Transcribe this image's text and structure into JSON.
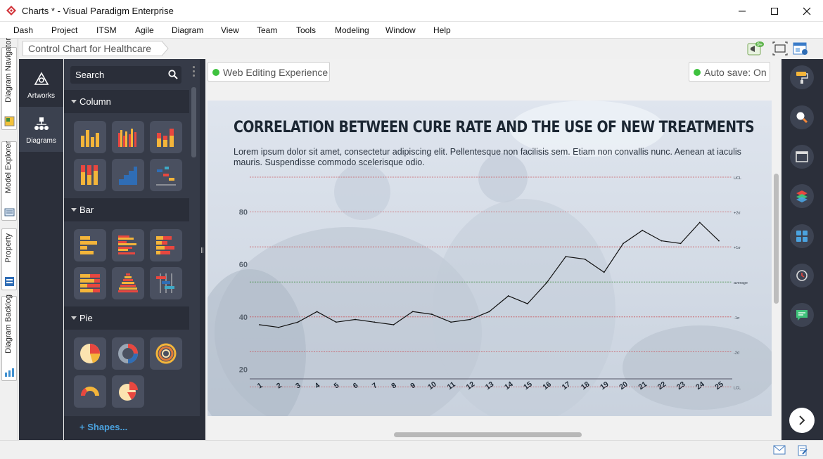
{
  "window": {
    "title": "Charts * - Visual Paradigm Enterprise"
  },
  "menu": [
    "Dash",
    "Project",
    "ITSM",
    "Agile",
    "Diagram",
    "View",
    "Team",
    "Tools",
    "Modeling",
    "Window",
    "Help"
  ],
  "breadcrumb": "Control Chart for Healthcare",
  "notification_badge": "9+",
  "left_tabs": [
    "Diagram Navigator",
    "Model Explorer",
    "Property",
    "Diagram Backlog"
  ],
  "nav": {
    "artworks": "Artworks",
    "diagrams": "Diagrams"
  },
  "palette": {
    "search_placeholder": "Search",
    "categories": [
      "Column",
      "Bar",
      "Pie"
    ],
    "shapes_link": "+ Shapes..."
  },
  "canvas": {
    "web_editing": "Web Editing Experience",
    "autosave": "Auto save: On"
  },
  "chart_data": {
    "type": "line",
    "title": "Correlation between cure rate and the use of new treatments",
    "description": "Lorem ipsum dolor sit amet, consectetur adipiscing elit. Pellentesque non facilisis sem. Etiam non convallis nunc. Aenean at iaculis mauris. Suspendisse commodo scelerisque odio.",
    "x": [
      "1",
      "2",
      "3",
      "4",
      "5",
      "6",
      "7",
      "8",
      "9",
      "10",
      "11",
      "12",
      "13",
      "14",
      "15",
      "16",
      "17",
      "18",
      "19",
      "20",
      "21",
      "22",
      "23",
      "24",
      "25"
    ],
    "values": [
      37,
      36,
      38,
      42,
      38,
      39,
      38,
      37,
      42,
      41,
      38,
      39,
      42,
      48,
      45,
      53,
      63,
      62,
      57,
      68,
      73,
      69,
      68,
      76,
      69
    ],
    "y_ticks": [
      "20",
      "40",
      "60",
      "80"
    ],
    "ylim": [
      0,
      100
    ],
    "control_lines": [
      {
        "label": "UCL",
        "value": 93.3,
        "color": "#c9454b"
      },
      {
        "label": "+2σ",
        "value": 80,
        "color": "#c9454b"
      },
      {
        "label": "+1σ",
        "value": 66.7,
        "color": "#c9454b"
      },
      {
        "label": "average",
        "value": 53.3,
        "color": "#3a8a3a"
      },
      {
        "label": "-1σ",
        "value": 40,
        "color": "#c9454b"
      },
      {
        "label": "-2σ",
        "value": 26.7,
        "color": "#c9454b"
      },
      {
        "label": "LCL",
        "value": 13.3,
        "color": "#c9454b"
      }
    ],
    "grid": false
  },
  "colors": {
    "accent_green": "#3fc23f",
    "dark_panel": "#2b2f3a",
    "shapes_link": "#4ba3e0"
  }
}
